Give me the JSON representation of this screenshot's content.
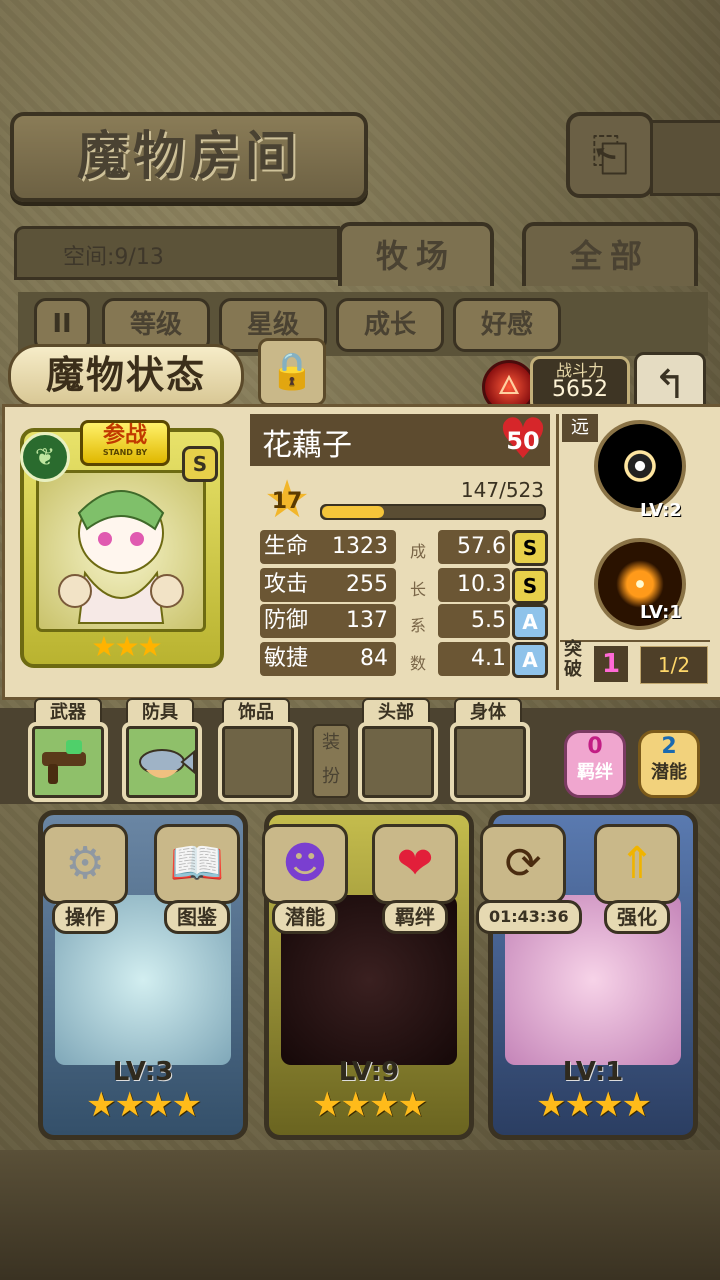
{
  "header": {
    "title": "魔物房间",
    "back_icon": "return-arrow-icon"
  },
  "capacity": {
    "label": "空间:9/13"
  },
  "tabs": [
    {
      "label": "牧场"
    },
    {
      "label": "全部"
    }
  ],
  "sort_buttons": [
    "等级",
    "星级",
    "成长",
    "好感"
  ],
  "pause_label": "II",
  "status": {
    "title": "魔物状态",
    "power_label": "战斗力",
    "power_value": "5652"
  },
  "monster": {
    "name": "花藕子",
    "level": "50",
    "star_rank": "17",
    "exp_text": "147/523",
    "exp_progress": 0.281,
    "standby_label": "参战",
    "standby_sub": "STAND BY",
    "rank": "S",
    "stars": "★★★",
    "stats": [
      {
        "label": "生命",
        "value": "1323",
        "growth": "57.6",
        "grade": "S",
        "side": "成"
      },
      {
        "label": "攻击",
        "value": "255",
        "growth": "10.3",
        "grade": "S",
        "side": "长"
      },
      {
        "label": "防御",
        "value": "137",
        "growth": "5.5",
        "grade": "A",
        "side": "系"
      },
      {
        "label": "敏捷",
        "value": "84",
        "growth": "4.1",
        "grade": "A",
        "side": "数"
      }
    ],
    "range_tag": "远",
    "skills": [
      {
        "level": "LV:2"
      },
      {
        "level": "LV:1"
      }
    ],
    "breakthrough_label": "突破",
    "breakthrough_value": "1",
    "breakthrough_progress": "1/2"
  },
  "equipment": {
    "slots": [
      {
        "label": "武器"
      },
      {
        "label": "防具"
      },
      {
        "label": "饰品"
      },
      {
        "label": "头部"
      },
      {
        "label": "身体"
      }
    ],
    "dress_label": "装扮",
    "bond": {
      "count": "0",
      "label": "羁绊"
    },
    "potential": {
      "count": "2",
      "label": "潜能"
    }
  },
  "actions": [
    {
      "label": "操作",
      "icon": "gear-icon"
    },
    {
      "label": "图鉴",
      "icon": "book-icon"
    },
    {
      "label": "潜能",
      "icon": "demon-icon"
    },
    {
      "label": "羁绊",
      "icon": "heart-icon"
    },
    {
      "label": "01:43:36",
      "icon": "gift-refresh-icon"
    },
    {
      "label": "强化",
      "icon": "up-arrow-icon"
    }
  ],
  "cards": [
    {
      "level": "LV:3",
      "stars": "★★★★"
    },
    {
      "level": "LV:9",
      "stars": "★★★★"
    },
    {
      "level": "LV:1",
      "stars": "★★★★"
    }
  ],
  "colors": {
    "panel": "#e9dcb7",
    "exp_fill": "#f5c53a",
    "grade_s": "#e7d04a",
    "grade_a": "#8fc3ea"
  }
}
